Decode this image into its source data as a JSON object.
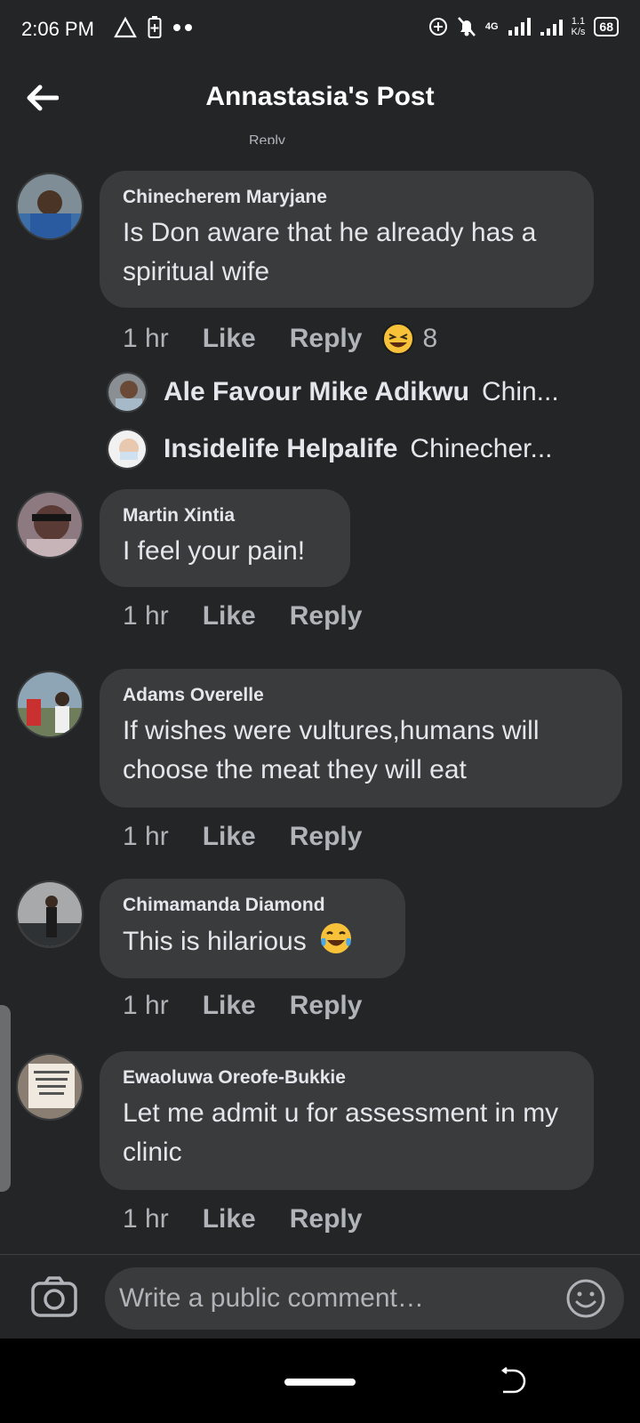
{
  "status_bar": {
    "time": "2:06 PM",
    "network": "4G",
    "speed_value": "1.1",
    "speed_unit": "K/s",
    "battery": "68"
  },
  "header": {
    "title": "Annastasia's Post"
  },
  "scroll_hint": "Reply",
  "comments": [
    {
      "author": "Chinecherem Maryjane",
      "text": "Is Don aware that he already has a spiritual wife",
      "time": "1 hr",
      "like": "Like",
      "reply": "Reply",
      "reaction_count": "8",
      "replies": [
        {
          "name": "Ale Favour Mike Adikwu",
          "snippet": "Chin..."
        },
        {
          "name": "Insidelife Helpalife",
          "snippet": "Chinecher..."
        }
      ]
    },
    {
      "author": "Martin Xintia",
      "text": "I feel your pain!",
      "time": "1 hr",
      "like": "Like",
      "reply": "Reply"
    },
    {
      "author": "Adams Overelle",
      "text": "If wishes were vultures,humans will choose the meat they will eat",
      "time": "1 hr",
      "like": "Like",
      "reply": "Reply"
    },
    {
      "author": "Chimamanda Diamond",
      "text": "This is hilarious",
      "time": "1 hr",
      "like": "Like",
      "reply": "Reply"
    },
    {
      "author": "Ewaoluwa Oreofe-Bukkie",
      "text": "Let me admit u for assessment in my clinic",
      "time": "1 hr",
      "like": "Like",
      "reply": "Reply"
    }
  ],
  "composer": {
    "placeholder": "Write a public comment…"
  },
  "colors": {
    "background": "#242527",
    "bubble": "#3a3b3c",
    "secondary_text": "#b0b3b8"
  }
}
